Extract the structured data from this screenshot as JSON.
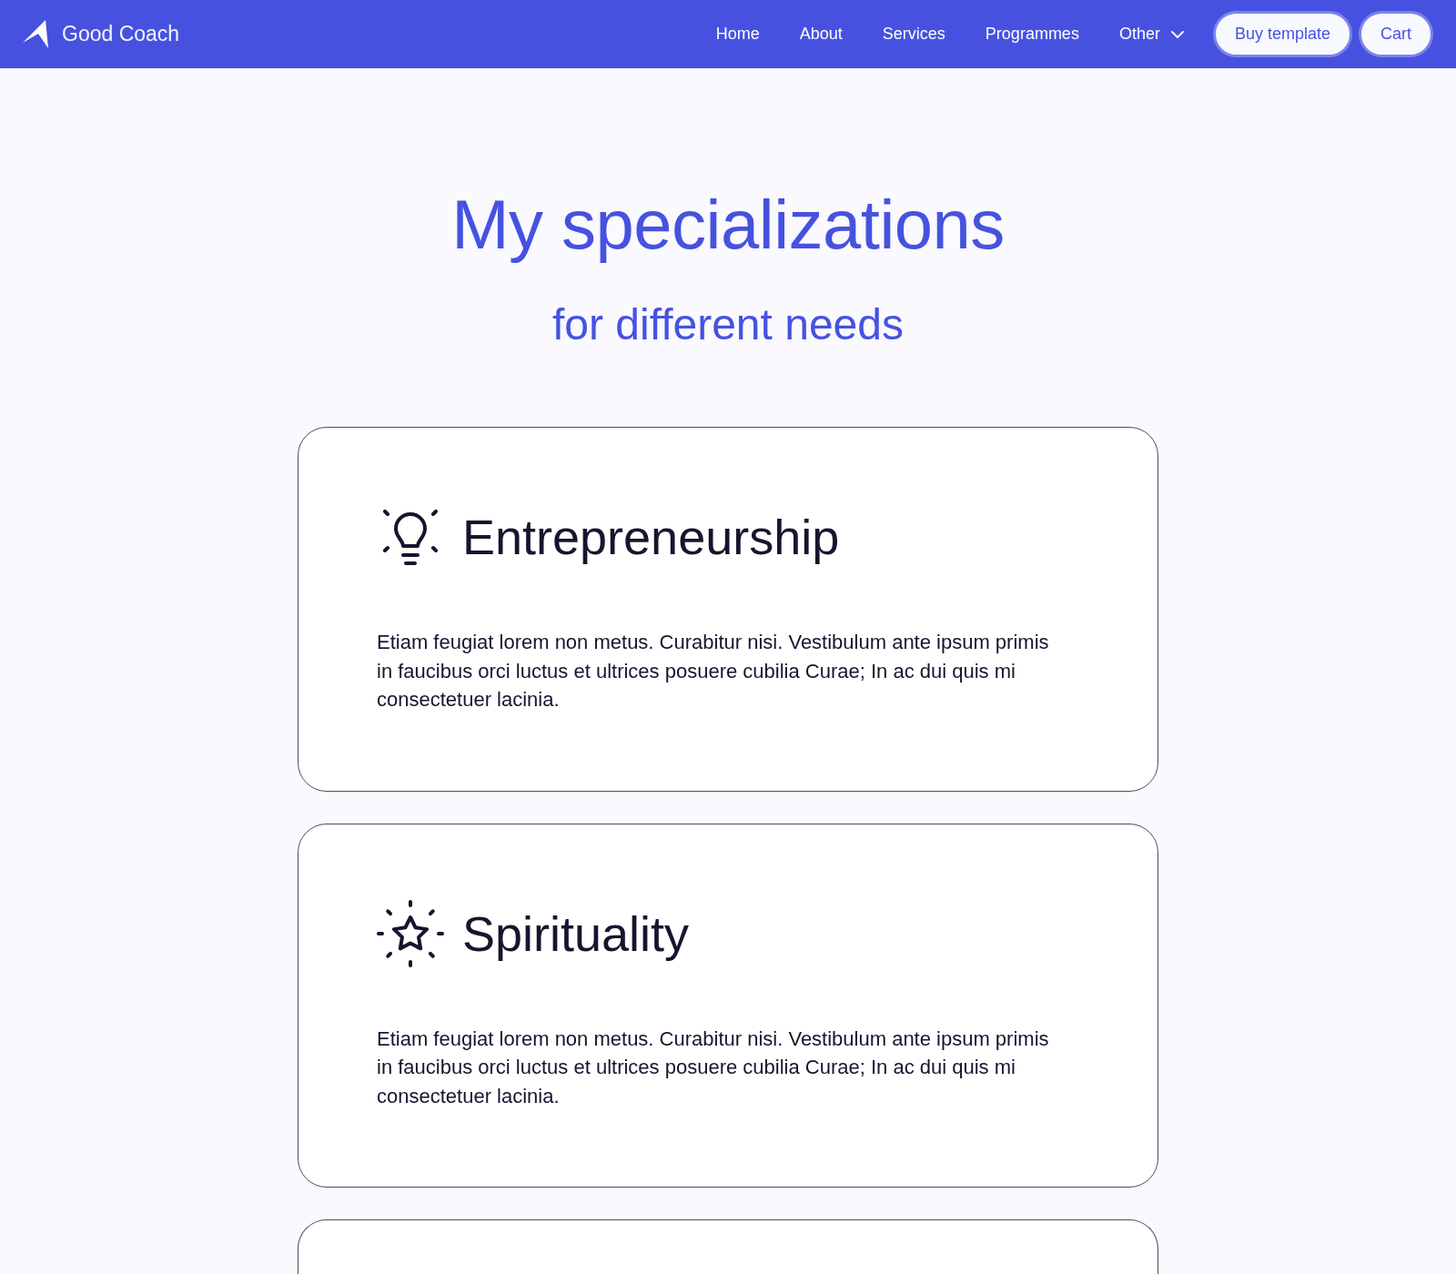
{
  "nav": {
    "brand": "Good Coach",
    "links": [
      {
        "label": "Home",
        "kind": "link"
      },
      {
        "label": "About",
        "kind": "link"
      },
      {
        "label": "Services",
        "kind": "link"
      },
      {
        "label": "Programmes",
        "kind": "link"
      },
      {
        "label": "Other",
        "kind": "dropdown"
      }
    ],
    "buttons": [
      "Buy template",
      "Cart"
    ]
  },
  "hero": {
    "title": "My specializations",
    "subtitle": "for different needs"
  },
  "cards": [
    {
      "kind": "business",
      "title": "Entrepreneurship",
      "text": "Etiam feugiat lorem non metus. Curabitur nisi. Vestibulum ante ipsum primis in faucibus orci luctus et ultrices posuere cubilia Curae; In ac dui quis mi consectetuer lacinia."
    },
    {
      "kind": "spiritual",
      "title": "Spirituality",
      "text": "Etiam feugiat lorem non metus. Curabitur nisi. Vestibulum ante ipsum primis in faucibus orci luctus et ultrices posuere cubilia Curae; In ac dui quis mi consectetuer lacinia."
    },
    {
      "kind": "blank"
    }
  ]
}
